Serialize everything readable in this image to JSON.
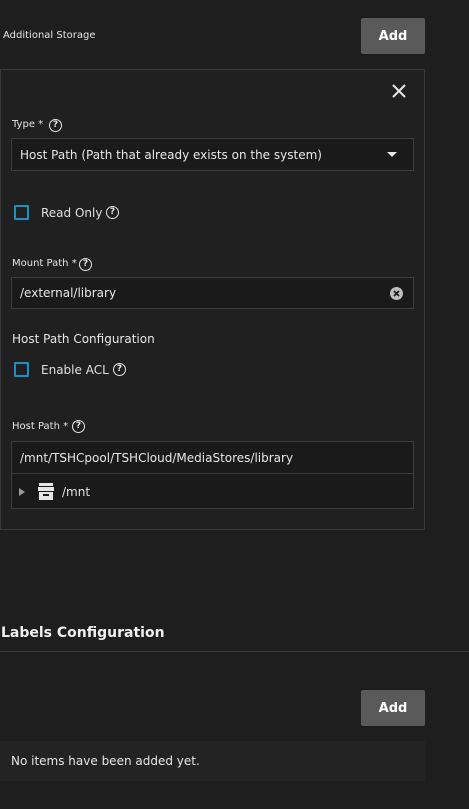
{
  "storage": {
    "title": "Additional Storage",
    "add_label": "Add",
    "type": {
      "label": "Type",
      "required": "*",
      "value": "Host Path (Path that already exists on the system)"
    },
    "read_only": {
      "label": "Read Only",
      "checked": false
    },
    "mount_path": {
      "label": "Mount Path",
      "required": "*",
      "value": "/external/library"
    },
    "host_path_config_title": "Host Path Configuration",
    "enable_acl": {
      "label": "Enable ACL",
      "checked": false
    },
    "host_path": {
      "label": "Host Path",
      "required": "*",
      "value": "/mnt/TSHCpool/TSHCloud/MediaStores/library",
      "tree_root": "/mnt"
    }
  },
  "labels_config": {
    "title": "Labels Configuration",
    "add_label": "Add",
    "empty_message": "No items have been added yet."
  },
  "colors": {
    "background": "#1e1e1e",
    "button": "#5a5a5a",
    "checkbox_border": "#1a90c8"
  }
}
